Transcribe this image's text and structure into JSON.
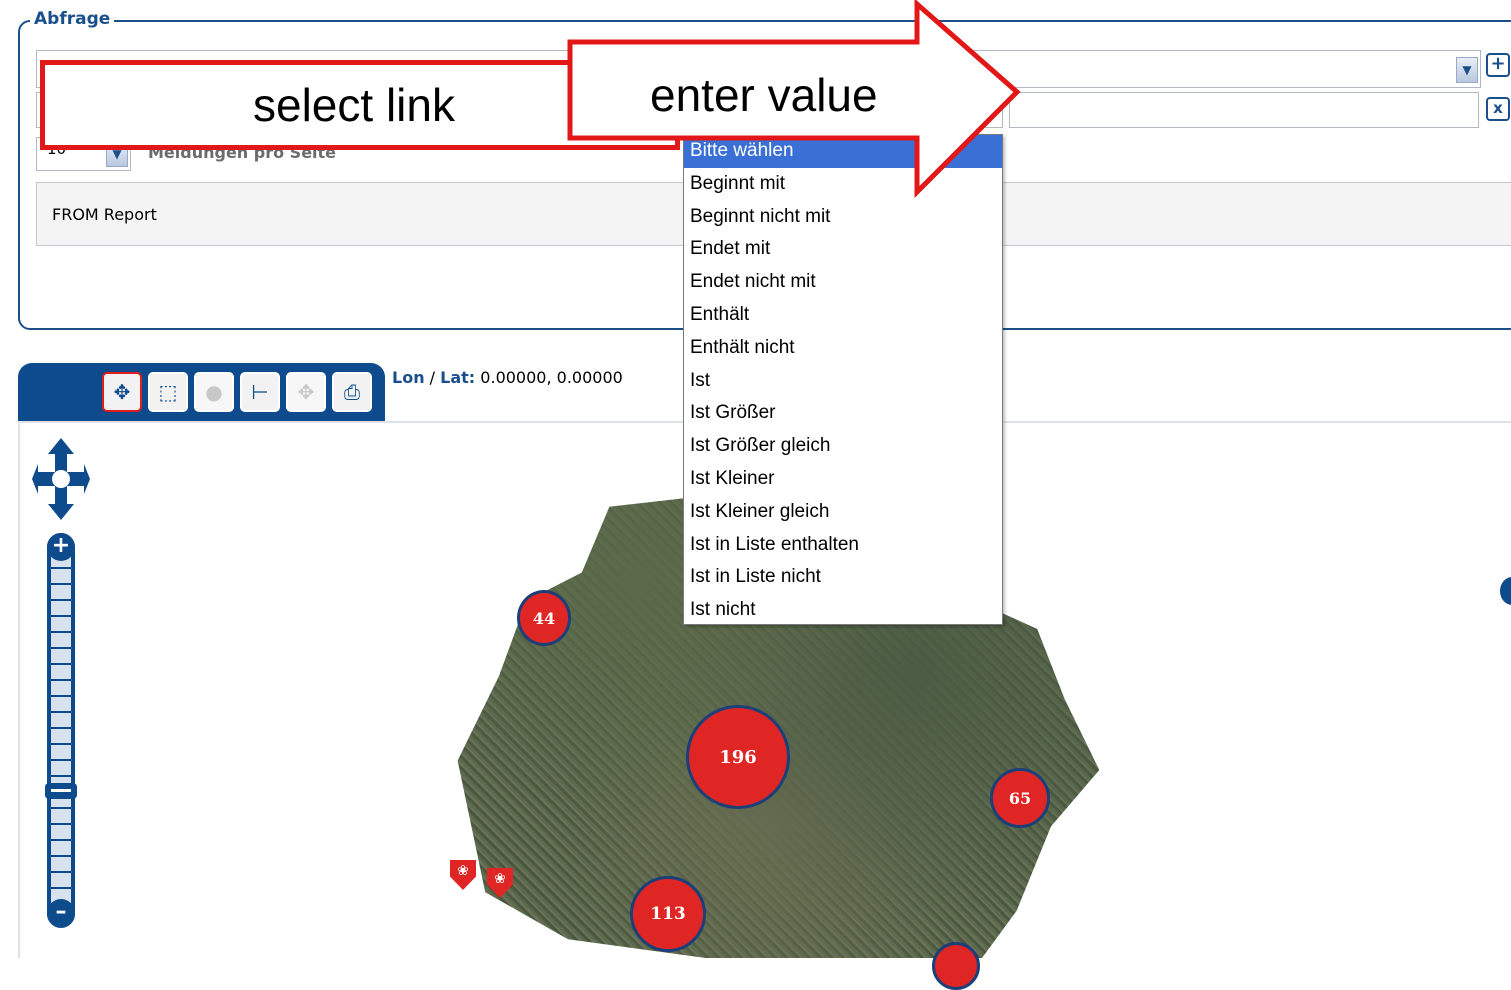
{
  "query_panel": {
    "legend": "Abfrage",
    "add_button": "+",
    "remove_button": "x",
    "per_page_value": "10",
    "per_page_label": "Meldungen pro Seite",
    "query_text": "FROM Report",
    "value_input": ""
  },
  "operator_dropdown": {
    "options": [
      "Bitte wählen",
      "Beginnt mit",
      "Beginnt nicht mit",
      "Endet mit",
      "Endet nicht mit",
      "Enthält",
      "Enthält nicht",
      "Ist",
      "Ist Größer",
      "Ist Größer gleich",
      "Ist Kleiner",
      "Ist Kleiner gleich",
      "Ist in Liste enthalten",
      "Ist in Liste nicht",
      "Ist nicht"
    ],
    "selected": "Bitte wählen"
  },
  "map": {
    "lon_label": "Lon",
    "separator": "/",
    "lat_label": "Lat:",
    "coords": "0.00000, 0.00000",
    "toolbar": [
      "pan-tool",
      "select-area-tool",
      "point-tool",
      "measure-tool",
      "zoom-extent-tool",
      "print-tool"
    ],
    "clusters": [
      "44",
      "196",
      "65",
      "113"
    ]
  },
  "annotations": {
    "select_link": "select link",
    "enter_value": "enter value"
  },
  "colors": {
    "brand_blue": "#1b4f8c",
    "cluster_red": "#e02525",
    "callout_red": "#e21818",
    "selected_blue": "#3a6fd6"
  }
}
